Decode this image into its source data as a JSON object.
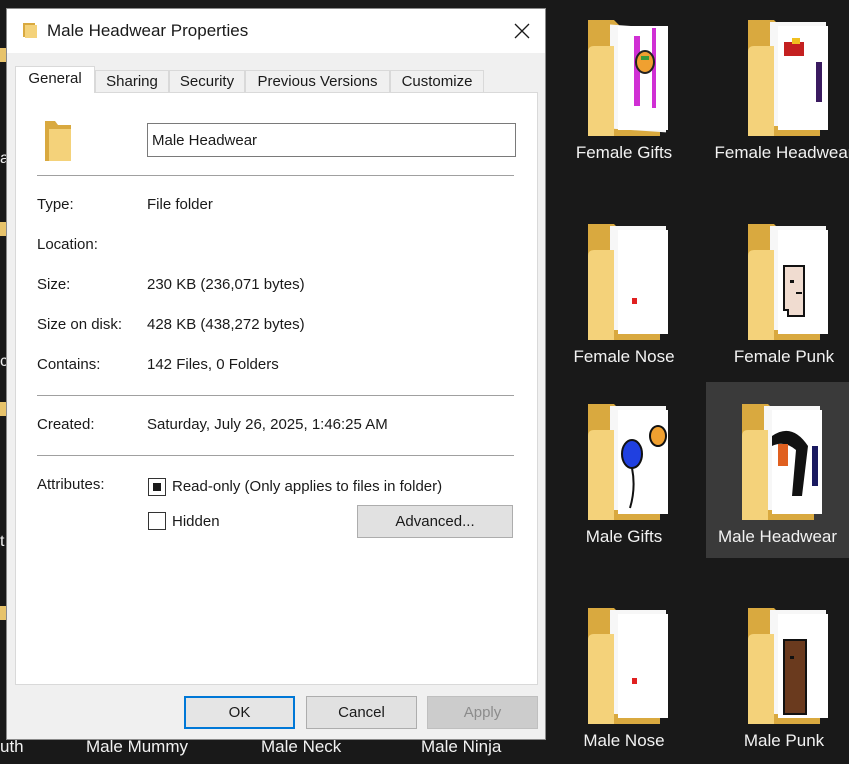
{
  "dialog": {
    "title": "Male Headwear Properties",
    "tabs": [
      "General",
      "Sharing",
      "Security",
      "Previous Versions",
      "Customize"
    ],
    "active_tab": "General",
    "name_value": "Male Headwear",
    "fields": {
      "type_label": "Type:",
      "type_value": "File folder",
      "location_label": "Location:",
      "location_value": "",
      "size_label": "Size:",
      "size_value": "230 KB (236,071 bytes)",
      "size_on_disk_label": "Size on disk:",
      "size_on_disk_value": "428 KB (438,272 bytes)",
      "contains_label": "Contains:",
      "contains_value": "142 Files, 0 Folders",
      "created_label": "Created:",
      "created_value": "Saturday, July 26, 2025, 1:46:25 AM"
    },
    "attributes": {
      "label": "Attributes:",
      "readonly_label": "Read-only (Only applies to files in folder)",
      "readonly_state": "indeterminate",
      "hidden_label": "Hidden",
      "hidden_checked": false,
      "advanced_label": "Advanced..."
    },
    "buttons": {
      "ok": "OK",
      "cancel": "Cancel",
      "apply": "Apply"
    }
  },
  "desktop": {
    "folders": [
      {
        "label": "Female Gifts",
        "preview": "gift-pixel-art"
      },
      {
        "label": "Female Headwear",
        "preview": "headwear-pixel-art"
      },
      {
        "label": "Female Nose",
        "preview": "nose-pixel-art"
      },
      {
        "label": "Female Punk",
        "preview": "punk-face-pixel-art"
      },
      {
        "label": "Male Gifts",
        "preview": "balloon-taco-pixel-art"
      },
      {
        "label": "Male Headwear",
        "preview": "headwear-pixel-art",
        "selected": true
      },
      {
        "label": "Male Nose",
        "preview": "nose-pixel-art"
      },
      {
        "label": "Male Punk",
        "preview": "dark-face-pixel-art"
      }
    ],
    "bottom_row_labels": [
      "uth",
      "Male Mummy",
      "Male Neck",
      "Male Ninja"
    ],
    "left_edge_fragments": [
      "a",
      "c",
      "t"
    ]
  },
  "colors": {
    "folder": "#e7c36b",
    "selection": "#0078d7",
    "desktop_bg": "#191919"
  }
}
